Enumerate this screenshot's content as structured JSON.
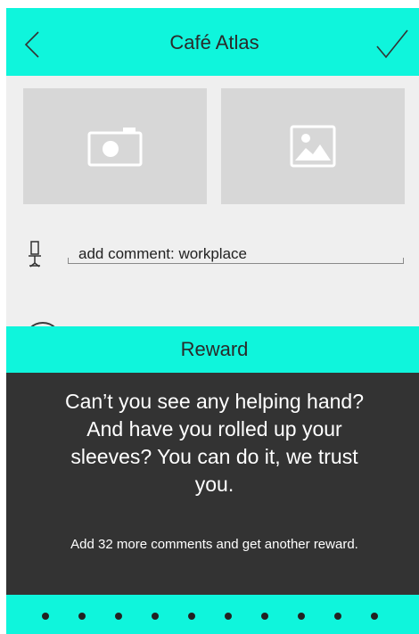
{
  "header": {
    "title": "Café Atlas",
    "back_icon": "chevron-left-icon",
    "confirm_icon": "checkmark-icon",
    "accent_color": "#0ff5dc"
  },
  "media": {
    "camera_icon": "camera-icon",
    "gallery_icon": "image-icon"
  },
  "comment": {
    "icon": "office-chair-icon",
    "value": "add comment: workplace"
  },
  "reward": {
    "title": "Reward",
    "message": "Can’t you see any helping hand? And have you rolled up your sleeves? You can do it, we trust you.",
    "subtext": "Add 32 more comments and get another reward.",
    "dot_count": 10
  }
}
